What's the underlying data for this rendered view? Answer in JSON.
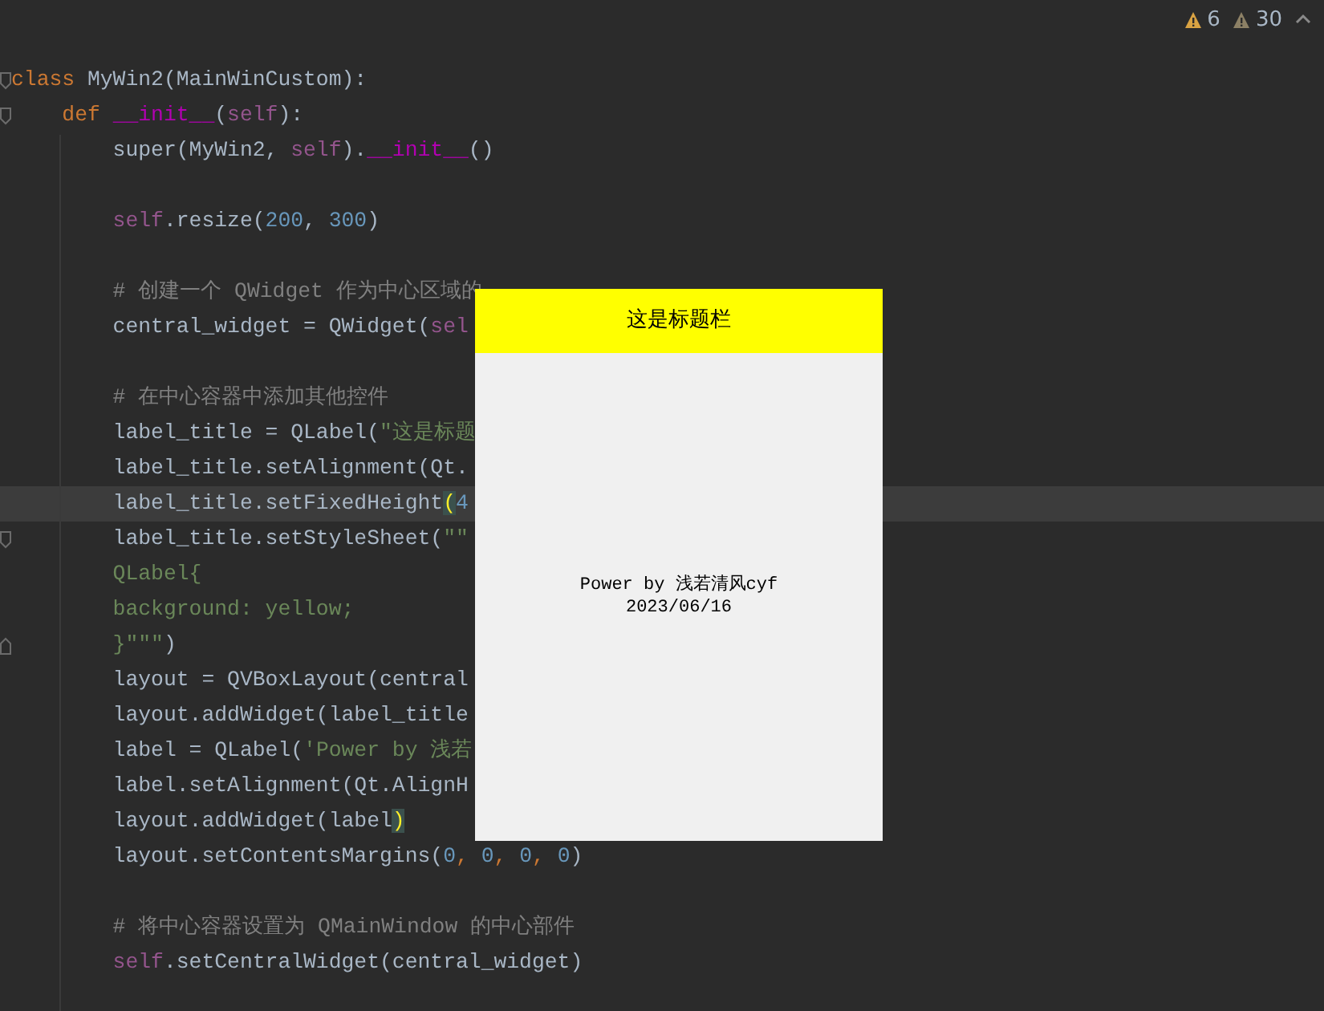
{
  "inspection": {
    "warnings": "6",
    "weak_warnings": "30"
  },
  "code_lines": [
    {
      "kind": "code",
      "fold": {
        "kind": "start"
      },
      "current": false,
      "tokens": [
        {
          "t": "class ",
          "kind": "kw"
        },
        {
          "t": "MyWin2(MainWinCustom):",
          "kind": "plain"
        }
      ]
    },
    {
      "kind": "code",
      "fold": {
        "kind": "start"
      },
      "current": false,
      "tokens": [
        {
          "t": "    def ",
          "kind": "kw"
        },
        {
          "t": "__init__",
          "kind": "magic"
        },
        {
          "t": "(",
          "kind": "plain"
        },
        {
          "t": "self",
          "kind": "self"
        },
        {
          "t": "):",
          "kind": "plain"
        }
      ]
    },
    {
      "kind": "code",
      "current": false,
      "tokens": [
        {
          "t": "        super(MyWin2, ",
          "kind": "plain"
        },
        {
          "t": "self",
          "kind": "self"
        },
        {
          "t": ").",
          "kind": "plain"
        },
        {
          "t": "__init__",
          "kind": "magic"
        },
        {
          "t": "()",
          "kind": "plain"
        }
      ]
    },
    {
      "kind": "blank"
    },
    {
      "kind": "code",
      "current": false,
      "tokens": [
        {
          "t": "        self",
          "kind": "self"
        },
        {
          "t": ".resize(",
          "kind": "plain"
        },
        {
          "t": "200",
          "kind": "num"
        },
        {
          "t": ", ",
          "kind": "plain"
        },
        {
          "t": "300",
          "kind": "num"
        },
        {
          "t": ")",
          "kind": "plain"
        }
      ]
    },
    {
      "kind": "blank"
    },
    {
      "kind": "code",
      "current": false,
      "tokens": [
        {
          "t": "        # 创建一个 QWidget 作为中心区域的",
          "kind": "comment"
        }
      ]
    },
    {
      "kind": "code",
      "current": false,
      "tokens": [
        {
          "t": "        central_widget = QWidget(",
          "kind": "plain"
        },
        {
          "t": "sel",
          "kind": "self"
        }
      ]
    },
    {
      "kind": "blank"
    },
    {
      "kind": "code",
      "current": false,
      "tokens": [
        {
          "t": "        # 在中心容器中添加其他控件",
          "kind": "comment"
        }
      ]
    },
    {
      "kind": "code",
      "current": false,
      "tokens": [
        {
          "t": "        label_title = QLabel(",
          "kind": "plain"
        },
        {
          "t": "\"这是标题",
          "kind": "str"
        }
      ]
    },
    {
      "kind": "code",
      "current": false,
      "tokens": [
        {
          "t": "        label_title.setAlignment(Qt.",
          "kind": "plain"
        }
      ]
    },
    {
      "kind": "code",
      "current": true,
      "tokens": [
        {
          "t": "        label_title.setFixedHeight",
          "kind": "plain"
        },
        {
          "t": "(",
          "kind": "match"
        },
        {
          "t": "4",
          "kind": "num"
        }
      ]
    },
    {
      "kind": "code",
      "fold": {
        "kind": "start"
      },
      "current": false,
      "tokens": [
        {
          "t": "        label_title.setStyleSheet(",
          "kind": "plain"
        },
        {
          "t": "\"\"",
          "kind": "str"
        }
      ]
    },
    {
      "kind": "code",
      "current": false,
      "tokens": [
        {
          "t": "        QLabel{",
          "kind": "str"
        }
      ]
    },
    {
      "kind": "code",
      "current": false,
      "tokens": [
        {
          "t": "        background: yellow;",
          "kind": "str"
        }
      ]
    },
    {
      "kind": "code",
      "fold": {
        "kind": "end"
      },
      "current": false,
      "tokens": [
        {
          "t": "        }\"\"\"",
          "kind": "str"
        },
        {
          "t": ")",
          "kind": "plain"
        }
      ]
    },
    {
      "kind": "code",
      "current": false,
      "tokens": [
        {
          "t": "        layout = QVBoxLayout(central",
          "kind": "plain"
        }
      ]
    },
    {
      "kind": "code",
      "current": false,
      "tokens": [
        {
          "t": "        layout.addWidget(label_title",
          "kind": "plain"
        }
      ]
    },
    {
      "kind": "code",
      "current": false,
      "tokens": [
        {
          "t": "        label = QLabel(",
          "kind": "plain"
        },
        {
          "t": "'Power by 浅若",
          "kind": "str"
        }
      ]
    },
    {
      "kind": "code",
      "current": false,
      "tokens": [
        {
          "t": "        label.setAlignment(Qt.AlignH",
          "kind": "plain"
        }
      ]
    },
    {
      "kind": "code",
      "current": false,
      "tokens": [
        {
          "t": "        layout.addWidget(label",
          "kind": "plain"
        },
        {
          "t": ")",
          "kind": "match"
        }
      ]
    },
    {
      "kind": "code",
      "current": false,
      "tokens": [
        {
          "t": "        layout.setContentsMargins(",
          "kind": "plain"
        },
        {
          "t": "0",
          "kind": "num"
        },
        {
          "t": ", ",
          "kind": "kw"
        },
        {
          "t": "0",
          "kind": "num"
        },
        {
          "t": ", ",
          "kind": "kw"
        },
        {
          "t": "0",
          "kind": "num"
        },
        {
          "t": ", ",
          "kind": "kw"
        },
        {
          "t": "0",
          "kind": "num"
        },
        {
          "t": ")",
          "kind": "plain"
        }
      ]
    },
    {
      "kind": "blank"
    },
    {
      "kind": "code",
      "current": false,
      "tokens": [
        {
          "t": "        # 将中心容器设置为 QMainWindow 的中心部件",
          "kind": "comment"
        }
      ]
    },
    {
      "kind": "code",
      "current": false,
      "tokens": [
        {
          "t": "        self",
          "kind": "self"
        },
        {
          "t": ".setCentralWidget(central_widget)",
          "kind": "plain"
        }
      ]
    }
  ],
  "preview_window": {
    "title_label": "这是标题栏",
    "body_lines": [
      "Power by 浅若清风cyf",
      "2023/06/16"
    ]
  }
}
